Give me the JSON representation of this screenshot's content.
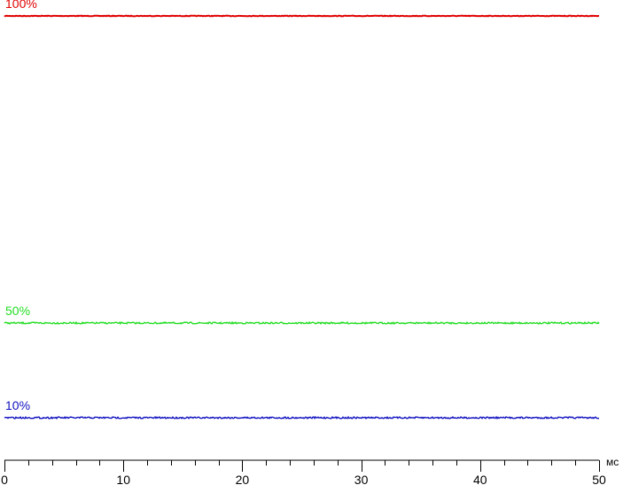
{
  "chart_data": {
    "type": "line",
    "x_unit": "мс",
    "xlim": [
      0,
      50
    ],
    "x_major_ticks": [
      "0",
      "10",
      "20",
      "30",
      "40",
      "50"
    ],
    "x_minor_step": 2,
    "series": [
      {
        "name": "100%",
        "level": 100,
        "color": "#e00000",
        "values_x": [
          0,
          50
        ],
        "values_y": [
          100,
          100
        ]
      },
      {
        "name": "50%",
        "level": 50,
        "color": "#22dd22",
        "values_x": [
          0,
          50
        ],
        "values_y": [
          50,
          50
        ]
      },
      {
        "name": "10%",
        "level": 10,
        "color": "#1010c0",
        "values_x": [
          0,
          50
        ],
        "values_y": [
          10,
          10
        ]
      }
    ],
    "grid": false,
    "legend": "none"
  }
}
